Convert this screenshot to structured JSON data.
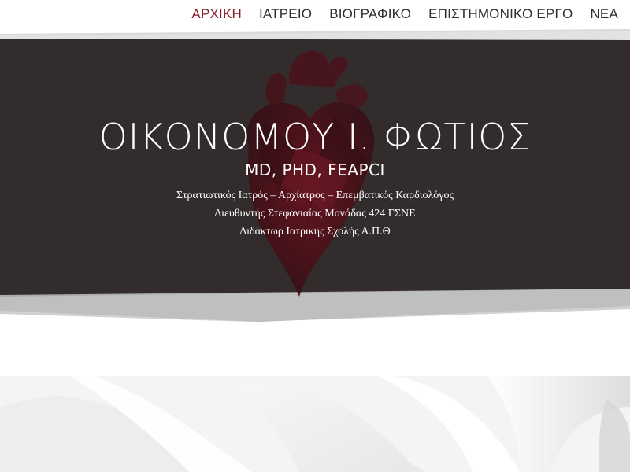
{
  "nav": {
    "items": [
      {
        "label": "ΑΡΧΙΚΗ",
        "active": true
      },
      {
        "label": "ΙΑΤΡΕΙΟ",
        "active": false
      },
      {
        "label": "ΒΙΟΓΡΑΦΙΚΟ",
        "active": false
      },
      {
        "label": "ΕΠΙΣΤΗΜΟΝΙΚΟ ΕΡΓΟ",
        "active": false
      },
      {
        "label": "ΝΕΑ",
        "active": false
      }
    ]
  },
  "hero": {
    "name": "ΟΙΚΟΝΟΜΟΥ Ι. ΦΩΤΙΟΣ",
    "credentials": "MD, PHD, FEAPCI",
    "lines": [
      "Στρατιωτικός Ιατρός – Αρχίατρος – Επεμβατικός Καρδιολόγος",
      "Διευθυντής Στεφανιαίας Μονάδας 424 ΓΣΝΕ",
      "Διδάκτωρ Ιατρικής Σχολής Α.Π.Θ"
    ]
  },
  "colors": {
    "accent": "#8a1f2a",
    "hero_overlay": "#322d2c",
    "nav_text": "#2f2f2f"
  }
}
